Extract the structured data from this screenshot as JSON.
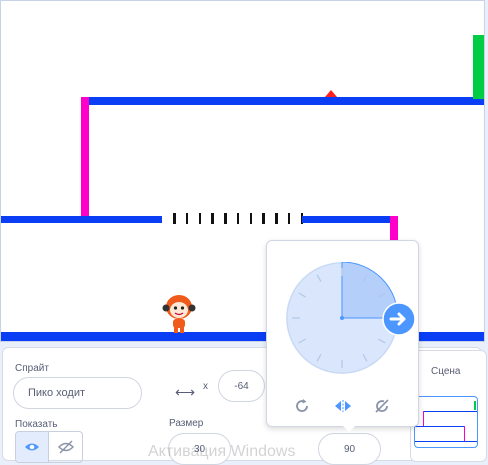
{
  "sprite_panel": {
    "sprite_label": "Спрайт",
    "sprite_name": "Пико ходит",
    "x_label": "x",
    "x_value": "-64",
    "show_label": "Показать",
    "size_label": "Размер",
    "size_value": "30",
    "direction_value": "90"
  },
  "scene_panel": {
    "title": "Сцена"
  },
  "direction_popover": {
    "direction_degrees": 90,
    "modes": [
      "all-around-icon",
      "left-right-icon",
      "dont-rotate-icon"
    ],
    "active_mode": "left-right-icon"
  },
  "watermark": "Активация Windows",
  "colors": {
    "platform_blue": "#0a3ef5",
    "wall_pink": "#ff00cc",
    "goal_green": "#00cc44",
    "accent": "#4c97ff"
  }
}
